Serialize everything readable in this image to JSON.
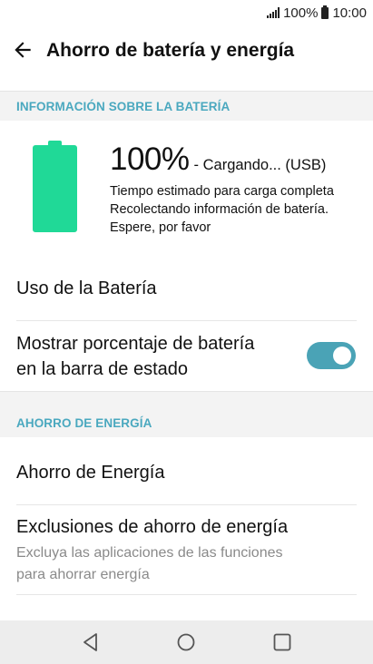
{
  "status_bar": {
    "battery_percent": "100%",
    "time": "10:00"
  },
  "header": {
    "title": "Ahorro de batería y energía"
  },
  "battery_section": {
    "header": "INFORMACIÓN SOBRE LA BATERÍA",
    "battery_level_percent": 100,
    "percent_text": "100%",
    "charging_text": "- Cargando... (USB)",
    "info_line_1": "Tiempo estimado para carga completa",
    "info_line_2": "Recolectando información de batería.",
    "info_line_3": "Espere, por favor"
  },
  "items": {
    "battery_usage": "Uso de la Batería",
    "show_percent_line_1": "Mostrar porcentaje de batería",
    "show_percent_line_2": "en la barra de estado",
    "show_percent_enabled": true
  },
  "energy_section": {
    "header": "AHORRO DE ENERGÍA",
    "energy_saver": "Ahorro de Energía",
    "exclusions_title": "Exclusiones de ahorro de energía",
    "exclusions_sub_line_1": "Excluya las aplicaciones de las funciones",
    "exclusions_sub_line_2": "para ahorrar energía"
  },
  "colors": {
    "accent": "#4aa8bf",
    "battery_green": "#20d997",
    "toggle_on": "#4aa3b6"
  },
  "icons": {
    "back": "arrow-left-icon",
    "nav_back": "triangle-back-icon",
    "nav_home": "circle-home-icon",
    "nav_recents": "square-recents-icon"
  }
}
